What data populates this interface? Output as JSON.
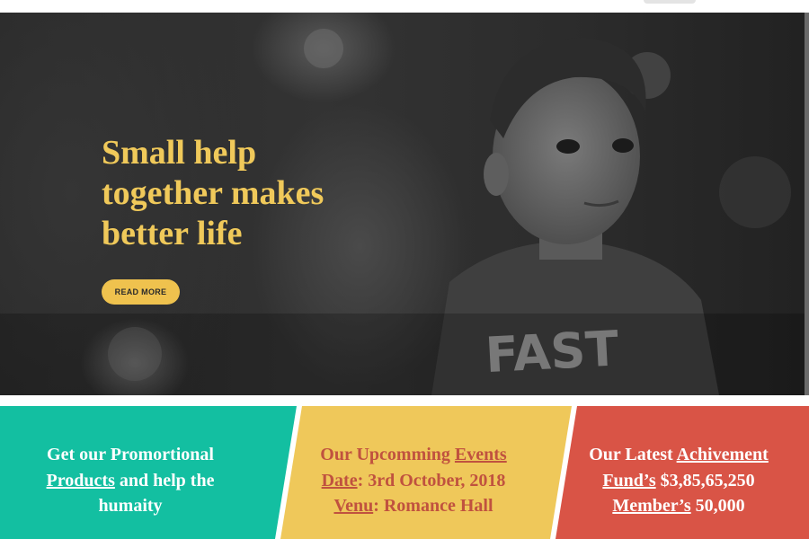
{
  "hero": {
    "heading": "Small help together makes better life",
    "button_label": "READ MORE",
    "shirt_text": "FAST"
  },
  "panels": {
    "products": {
      "line1": "Get our Promortional",
      "link": "Products",
      "line2": " and help the humaity"
    },
    "events": {
      "line1": "Our Upcomming",
      "link1": "Events Date",
      "line2": ": 3rd October, 2018 ",
      "link2": "Venu",
      "line3": ": Romance Hall"
    },
    "achievement": {
      "line1_prefix": "Our Latest ",
      "link1": "Achivement",
      "link2": "Fund’s",
      "fund_value": " $3,85,65,250",
      "link3": "Member’s",
      "member_value": " 50,000"
    }
  },
  "colors": {
    "accent_yellow": "#efc24e",
    "green": "#13bfa1",
    "yellow": "#efc85a",
    "red": "#d95446"
  }
}
